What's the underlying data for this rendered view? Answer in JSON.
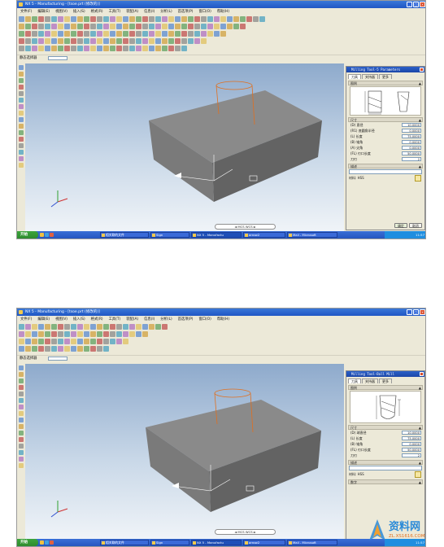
{
  "screenshots": [
    {
      "title": "NX 5 - Manufacturing - [tsoe.prt (修改的)]",
      "menu": [
        "文件(F)",
        "编辑(E)",
        "视图(V)",
        "插入(S)",
        "格式(R)",
        "工具(T)",
        "装配(A)",
        "信息(I)",
        "分析(L)",
        "首选项(P)",
        "窗口(O)",
        "帮助(H)"
      ],
      "selection_label": "静态选择器",
      "panel": {
        "title": "Milling Tool-5 Parameters",
        "tabs": [
          "刀具",
          "夹持器",
          "更多"
        ],
        "section_tool": "图例",
        "section_size": "尺寸",
        "params": [
          {
            "label": "(D) 直径",
            "value": "10.0000"
          },
          {
            "label": "(R1) 底圆角半径",
            "value": "0.0000"
          },
          {
            "label": "(L) 长度",
            "value": "75.0000"
          },
          {
            "label": "(B) 锥角",
            "value": "0.0000"
          },
          {
            "label": "(A) 尖角",
            "value": "0.0000"
          },
          {
            "label": "(FL) 刃口长度",
            "value": "50.0000"
          },
          {
            "label": "刀刃",
            "value": "2"
          }
        ],
        "section_desc": "描述",
        "material_label": "材料: HSS",
        "ok": "确定",
        "cancel": "取消"
      },
      "status_pill": "◄  MCS        WCS  ►",
      "taskbar": {
        "start": "开始",
        "tasks": [
          "相关联的文件",
          "Sign",
          "NX 5 - Manufactu",
          "arrow2",
          "Mail - Microsoft"
        ],
        "clock": "11:57"
      }
    },
    {
      "title": "NX 5 - Manufacturing - [tsoe.prt (修改的)]",
      "menu": [
        "文件(F)",
        "编辑(E)",
        "视图(V)",
        "插入(S)",
        "格式(R)",
        "工具(T)",
        "装配(A)",
        "信息(I)",
        "分析(L)",
        "首选项(P)",
        "窗口(O)",
        "帮助(H)"
      ],
      "selection_label": "静态选择器",
      "panel": {
        "title": "Milling Tool-Ball Mill",
        "tabs": [
          "刀具",
          "夹持器",
          "更多"
        ],
        "section_tool": "图例",
        "section_size": "尺寸",
        "params": [
          {
            "label": "(D) 球直径",
            "value": "10.0000"
          },
          {
            "label": "(L) 长度",
            "value": "75.0000"
          },
          {
            "label": "(B) 锥角",
            "value": "0.0000"
          },
          {
            "label": "(FL) 刃口长度",
            "value": "50.0000"
          },
          {
            "label": "刀刃",
            "value": "2"
          }
        ],
        "section_desc": "描述",
        "material_label": "材料: HSS",
        "section_number": "数字"
      },
      "status_pill": "◄  MCS        WCS  ►",
      "taskbar": {
        "start": "开始",
        "tasks": [
          "相关联的文件",
          "Sign",
          "NX 5 - Manufactu",
          "arrow2",
          "Mail - Microsoft"
        ],
        "clock": "11:57"
      }
    }
  ],
  "watermark": {
    "text": "资料网",
    "url": "ZL.XS1616.COM"
  },
  "colors": {
    "title_bar": "#1f56c4",
    "block_top": "#8a8a8a",
    "block_side": "#6e6e6e",
    "tool_outline": "#e07020",
    "watermark_text": "#2a8ad8",
    "watermark_url": "#e07020"
  }
}
